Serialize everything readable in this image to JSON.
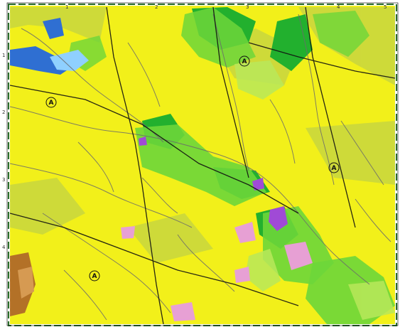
{
  "map": {
    "type": "topographic-geologic-map-sheet",
    "colors": {
      "background": "#f2f01a",
      "frame": "#ffffff",
      "neatline": "#2a6e2a",
      "green_dark": "#22b02e",
      "green_mid": "#6dd63a",
      "green_light": "#b9e85a",
      "olive": "#c8d640",
      "water_blue": "#2f6fd2",
      "water_light": "#8fd0ff",
      "violet": "#a04ad6",
      "pink": "#e7a0d4",
      "brown": "#a85a2a",
      "road_black": "#111111",
      "stream_grey": "#6b6b6b"
    },
    "top_edge_numbers": [
      "1",
      "2",
      "3",
      "4",
      "5"
    ],
    "left_edge_numbers": [
      "1",
      "2",
      "3",
      "4"
    ],
    "circled_labels": [
      "A",
      "A",
      "A",
      "A"
    ]
  }
}
